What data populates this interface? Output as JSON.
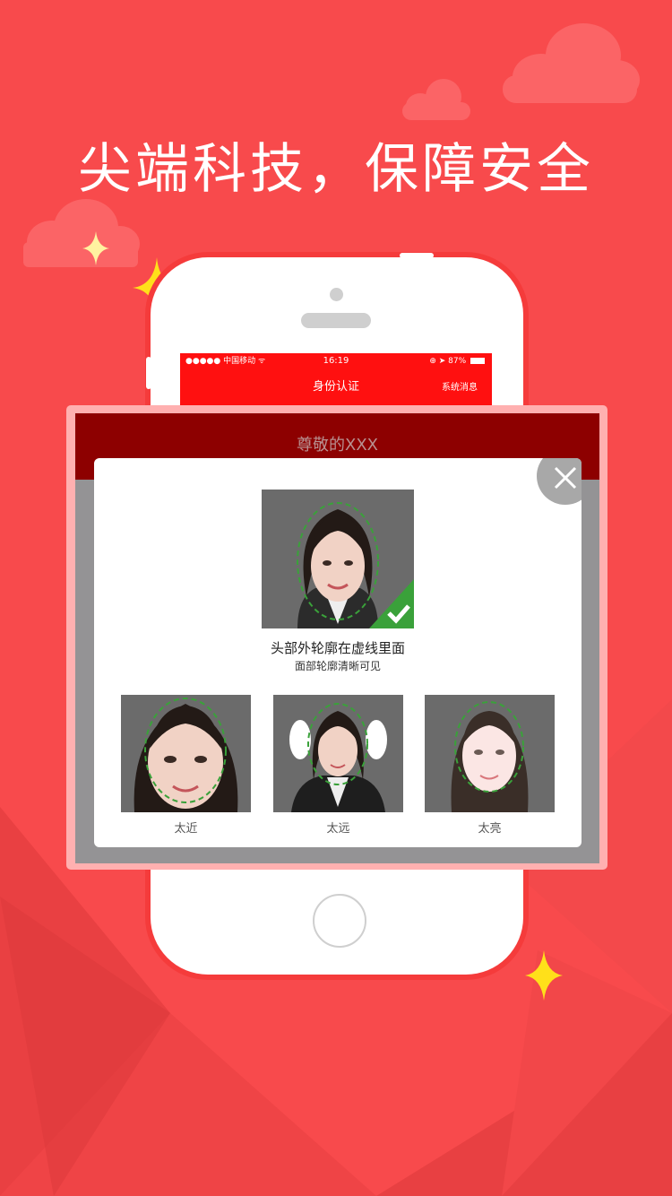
{
  "headline": "尖端科技，保障安全",
  "phone_screen": {
    "status": {
      "carrier": "●●●●● 中国移动 ᯤ",
      "time": "16:19",
      "battery": "⊕ ➤ 87%"
    },
    "nav_title": "身份认证",
    "nav_right": "系统消息"
  },
  "overlay": {
    "greeting": "尊敬的XXX"
  },
  "dialog": {
    "main_caption": "头部外轮廓在虚线里面",
    "sub_caption": "面部轮廓清晰可见",
    "examples": [
      {
        "label": "太近"
      },
      {
        "label": "太远"
      },
      {
        "label": "太亮"
      }
    ]
  },
  "colors": {
    "background": "#f84a4c",
    "nav_red": "#ff1010",
    "overlay_header": "#8d0000",
    "check_green": "#3aa13a",
    "sparkle": "#ffe01a"
  },
  "icons": [
    "close-icon",
    "check-icon",
    "wifi-icon",
    "battery-icon",
    "sparkle-icon"
  ]
}
